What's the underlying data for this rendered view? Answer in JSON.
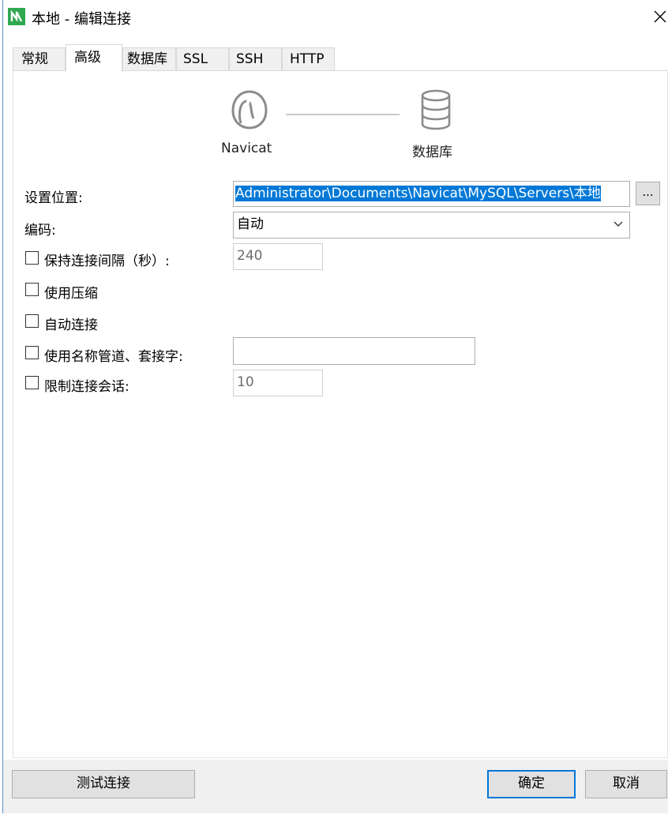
{
  "window": {
    "title": "本地 - 编辑连接"
  },
  "tabs": [
    {
      "label": "常规"
    },
    {
      "label": "高级"
    },
    {
      "label": "数据库"
    },
    {
      "label": "SSL"
    },
    {
      "label": "SSH"
    },
    {
      "label": "HTTP"
    }
  ],
  "active_tab": "高级",
  "diagram": {
    "left_label": "Navicat",
    "right_label": "数据库"
  },
  "form": {
    "location_label": "设置位置:",
    "location_value": "Administrator\\Documents\\Navicat\\MySQL\\Servers\\本地",
    "browse_label": "...",
    "encoding_label": "编码:",
    "encoding_value": "自动",
    "keepalive_label": "保持连接间隔（秒）:",
    "keepalive_value": "240",
    "keepalive_checked": false,
    "compression_label": "使用压缩",
    "compression_checked": false,
    "autoconnect_label": "自动连接",
    "autoconnect_checked": false,
    "namedpipe_label": "使用名称管道、套接字:",
    "namedpipe_value": "",
    "namedpipe_checked": false,
    "sessionlimit_label": "限制连接会话:",
    "sessionlimit_value": "10",
    "sessionlimit_checked": false
  },
  "footer": {
    "test_button": "测试连接",
    "ok_button": "确定",
    "cancel_button": "取消"
  },
  "colors": {
    "selection": "#0078d7",
    "app_icon_green": "#2fa84f"
  }
}
